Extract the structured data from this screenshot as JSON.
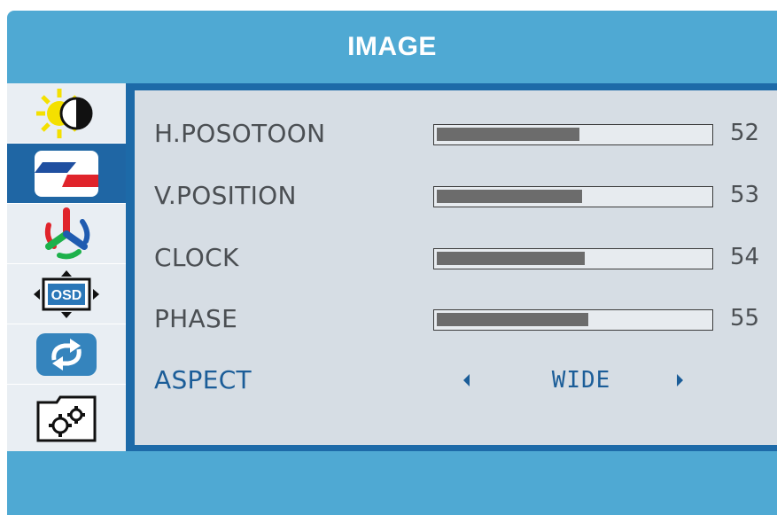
{
  "menu": {
    "title": "IMAGE"
  },
  "sidebar": {
    "items": [
      {
        "icon": "brightness-contrast-icon",
        "active": false
      },
      {
        "icon": "image-icon",
        "active": true
      },
      {
        "icon": "color-rgb-icon",
        "active": false
      },
      {
        "icon": "osd-settings-icon",
        "active": false
      },
      {
        "icon": "reset-icon",
        "active": false
      },
      {
        "icon": "misc-settings-icon",
        "active": false
      }
    ]
  },
  "settings": [
    {
      "label": "H.POSOTOON",
      "value": "52",
      "level_percent": 52
    },
    {
      "label": "V.POSITION",
      "value": "53",
      "level_percent": 53
    },
    {
      "label": "CLOCK",
      "value": "54",
      "level_percent": 54
    },
    {
      "label": "PHASE",
      "value": "55",
      "level_percent": 55
    }
  ],
  "aspect": {
    "label": "ASPECT",
    "value": "WIDE"
  },
  "colors": {
    "frame": "#4fa9d3",
    "panel": "#d6dde4",
    "sidebar_active": "#1f66a4",
    "selected_text": "#1b5d98",
    "bar_fill": "#6c6c6c"
  }
}
